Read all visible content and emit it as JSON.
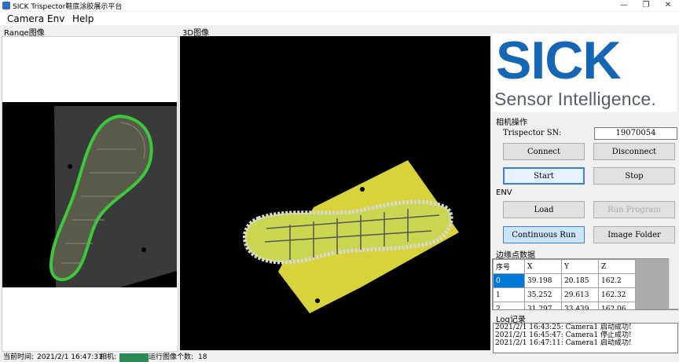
{
  "window": {
    "title": "SICK Trispector鞋底涂胶展示平台"
  },
  "menu": [
    "Camera",
    "Env",
    "Help"
  ],
  "panels": {
    "range_label": "Range图像",
    "d3_label": "3D图像"
  },
  "logo": {
    "brand": "SICK",
    "tagline": "Sensor Intelligence."
  },
  "camera_ops": {
    "section_label": "相机操作",
    "sn_label": "Trispector SN:",
    "sn_value": "19070054",
    "connect": "Connect",
    "disconnect": "Disconnect",
    "start": "Start",
    "stop": "Stop"
  },
  "env": {
    "section_label": "ENV",
    "load": "Load",
    "run_program": "Run Program",
    "continuous_run": "Continuous Run",
    "image_folder": "Image Folder"
  },
  "edge_data": {
    "section_label": "边缘点数据",
    "columns": [
      "序号",
      "X",
      "Y",
      "Z"
    ],
    "rows": [
      [
        "0",
        "39.198",
        "20.185",
        "162.2"
      ],
      [
        "1",
        "35.252",
        "29.613",
        "162.32"
      ],
      [
        "2",
        "31.297",
        "33.439",
        "162.06"
      ]
    ]
  },
  "log": {
    "section_label": "Log记录",
    "lines": [
      "2021/2/1 16:43:25: Camera1 启动成功!",
      "2021/2/1 16:45:47: Camera1 停止成功!",
      "2021/2/1 16:47:11: Camera1 启动成功!"
    ]
  },
  "status": {
    "time_label": "当前时间:",
    "time_value": "2021/2/1 16:47:31",
    "camera_label": "相机:",
    "camera_badge": "Started",
    "count_label": "运行图像个数:",
    "count_value": "18"
  },
  "colors": {
    "brand_blue": "#1566b5",
    "glue_green": "#3cc83c",
    "plate_yellow": "#d8d33a"
  }
}
